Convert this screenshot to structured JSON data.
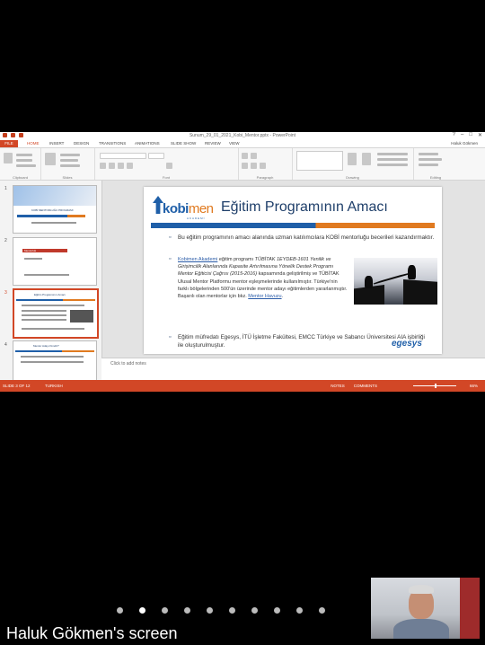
{
  "window": {
    "title": "Sunum_29_01_2021_Kobi_Mentor.pptx - PowerPoint"
  },
  "ribbon_tabs": [
    "FILE",
    "HOME",
    "INSERT",
    "DESIGN",
    "TRANSITIONS",
    "ANIMATIONS",
    "SLIDE SHOW",
    "REVIEW",
    "VIEW"
  ],
  "user_name": "Haluk Gökmen",
  "ribbon_groups": [
    "Clipboard",
    "Slides",
    "Font",
    "Paragraph",
    "Drawing",
    "Editing"
  ],
  "thumbnails": [
    {
      "num": "1",
      "caption": "KOBİ MENTORLUĞU PROGRAMI"
    },
    {
      "num": "2",
      "caption": "Mentorluk"
    },
    {
      "num": "3",
      "caption": "Eğitim Programının Amacı"
    },
    {
      "num": "4",
      "caption": "Mentor Adayı Kimdir?"
    }
  ],
  "slide": {
    "logo_kobi": "kobi",
    "logo_men": "men",
    "logo_sub": "AKADEMİ",
    "title": "Eğitim Programının Amacı",
    "bullet1": "Bu eğitim programının amacı alanında uzman katılımcılara KOBİ mentorluğu becerileri kazandırmaktır.",
    "bullet2": {
      "link1": "Kobimen Akademi",
      "t1": " eğitim programı ",
      "italic": "TÜBİTAK 1EYDEB-1601 Yenilik ve Girişimcilik Alanlarında Kapasite Artırılmasına Yönelik Destek Programı Mentor Eğiticisi Çağrısı (2015-2016)",
      "t2": " kapsamında geliştirilmiş ve TÜBİTAK Ulusal Mentor Platformu mentor eşleşmelerinde kullanılmıştır. Türkiye'nin farklı bölgelerinden 500'ün üzerinde mentor adayı eğitimlerden yararlanmıştır. Başarılı olan mentorlar için bkz. ",
      "link2": "Mentor Havuzu",
      "t3": "."
    },
    "bullet3": "Eğitim müfredatı Egesys, İTÜ İşletme Fakültesi, EMCC Türkiye ve Sabancı Üniversitesi AIA işbirliği ile oluşturulmuştur.",
    "egesys": "egesys"
  },
  "notes_placeholder": "Click to add notes",
  "status": {
    "slide_info": "SLIDE 3 OF 12",
    "language": "TURKISH",
    "notes": "NOTES",
    "comments": "COMMENTS",
    "zoom": "66%"
  },
  "screen_share": {
    "owner_label": "Haluk Gökmen's screen",
    "page_dots": 10,
    "active_dot": 1
  }
}
